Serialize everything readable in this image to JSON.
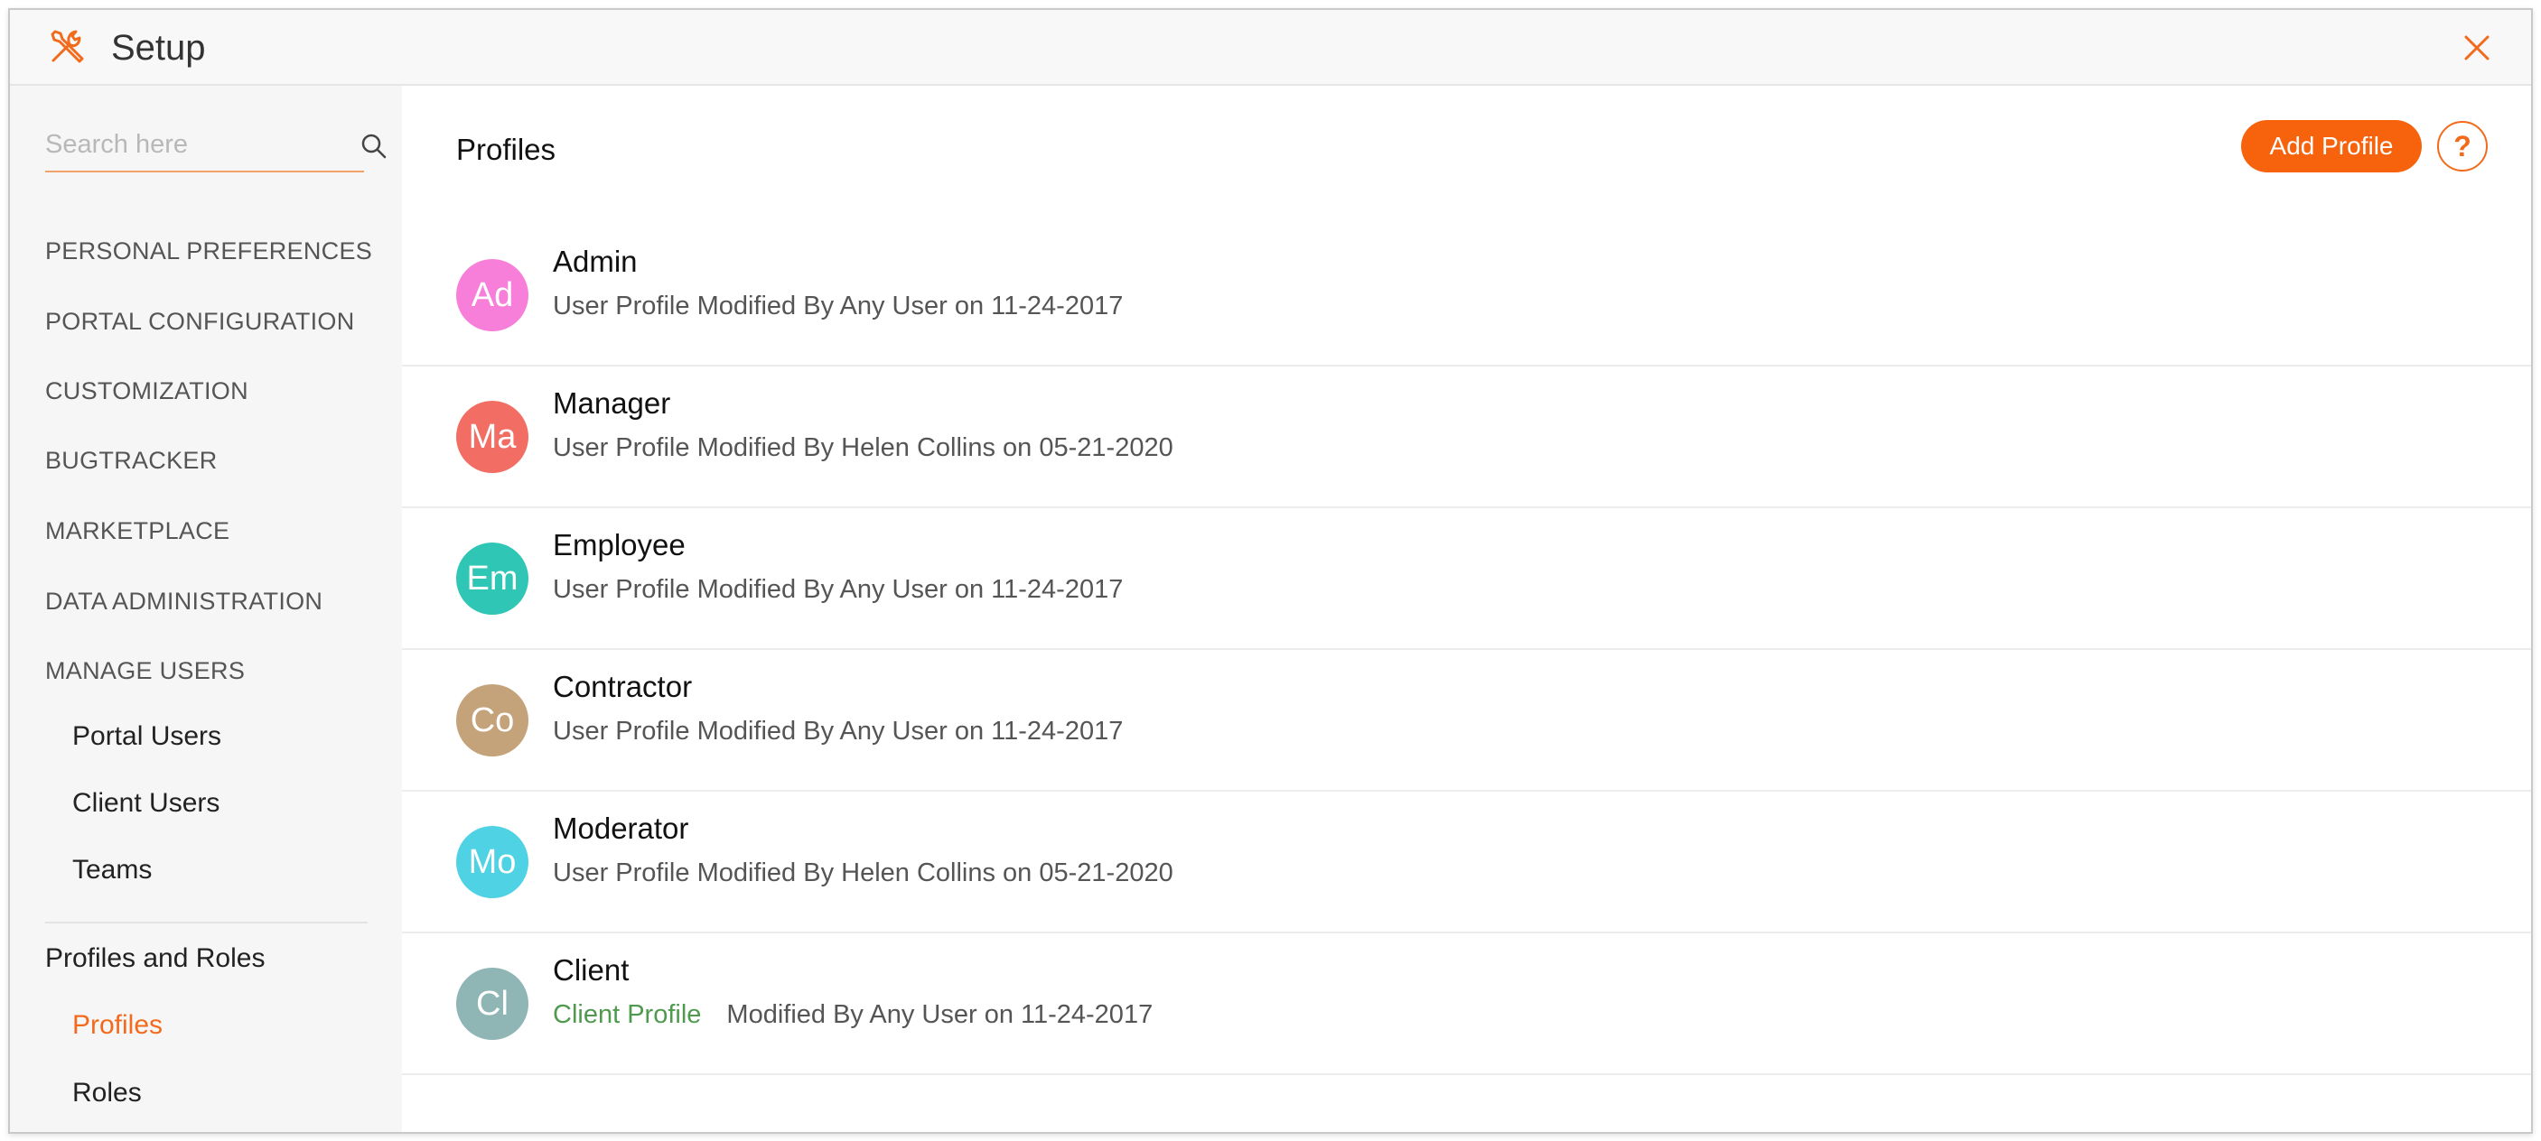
{
  "window": {
    "title": "Setup",
    "icon": "tools-icon",
    "close_icon": "close-icon"
  },
  "colors": {
    "accent": "#f7630c",
    "green_text": "#4f9a4f"
  },
  "search": {
    "placeholder": "Search here",
    "value": ""
  },
  "sidebar": {
    "sections": [
      {
        "label": "PERSONAL PREFERENCES"
      },
      {
        "label": "PORTAL CONFIGURATION"
      },
      {
        "label": "CUSTOMIZATION"
      },
      {
        "label": "BUGTRACKER"
      },
      {
        "label": "MARKETPLACE"
      },
      {
        "label": "DATA ADMINISTRATION"
      },
      {
        "label": "MANAGE USERS"
      }
    ],
    "manage_users_items": [
      {
        "label": "Portal Users"
      },
      {
        "label": "Client Users"
      },
      {
        "label": "Teams"
      }
    ],
    "group_title": "Profiles and Roles",
    "group_items": [
      {
        "label": "Profiles",
        "active": true
      },
      {
        "label": "Roles",
        "active": false
      }
    ]
  },
  "main": {
    "title": "Profiles",
    "add_button": "Add Profile",
    "help_button": "?",
    "profiles": [
      {
        "initials": "Ad",
        "name": "Admin",
        "color": "#f77fd9",
        "type_label": "User Profile",
        "meta": "Modified By Any User on 11-24-2017"
      },
      {
        "initials": "Ma",
        "name": "Manager",
        "color": "#f26d63",
        "type_label": "User Profile",
        "meta": "Modified By Helen Collins on 05-21-2020"
      },
      {
        "initials": "Em",
        "name": "Employee",
        "color": "#2fc6b5",
        "type_label": "User Profile",
        "meta": "Modified By Any User on 11-24-2017"
      },
      {
        "initials": "Co",
        "name": "Contractor",
        "color": "#c4a27a",
        "type_label": "User Profile",
        "meta": "Modified By Any User on 11-24-2017"
      },
      {
        "initials": "Mo",
        "name": "Moderator",
        "color": "#4fd2e3",
        "type_label": "User Profile",
        "meta": "Modified By Helen Collins on 05-21-2020"
      },
      {
        "initials": "Cl",
        "name": "Client",
        "color": "#8fb5b5",
        "type_label": "Client Profile",
        "meta": "Modified By Any User on 11-24-2017"
      }
    ]
  }
}
